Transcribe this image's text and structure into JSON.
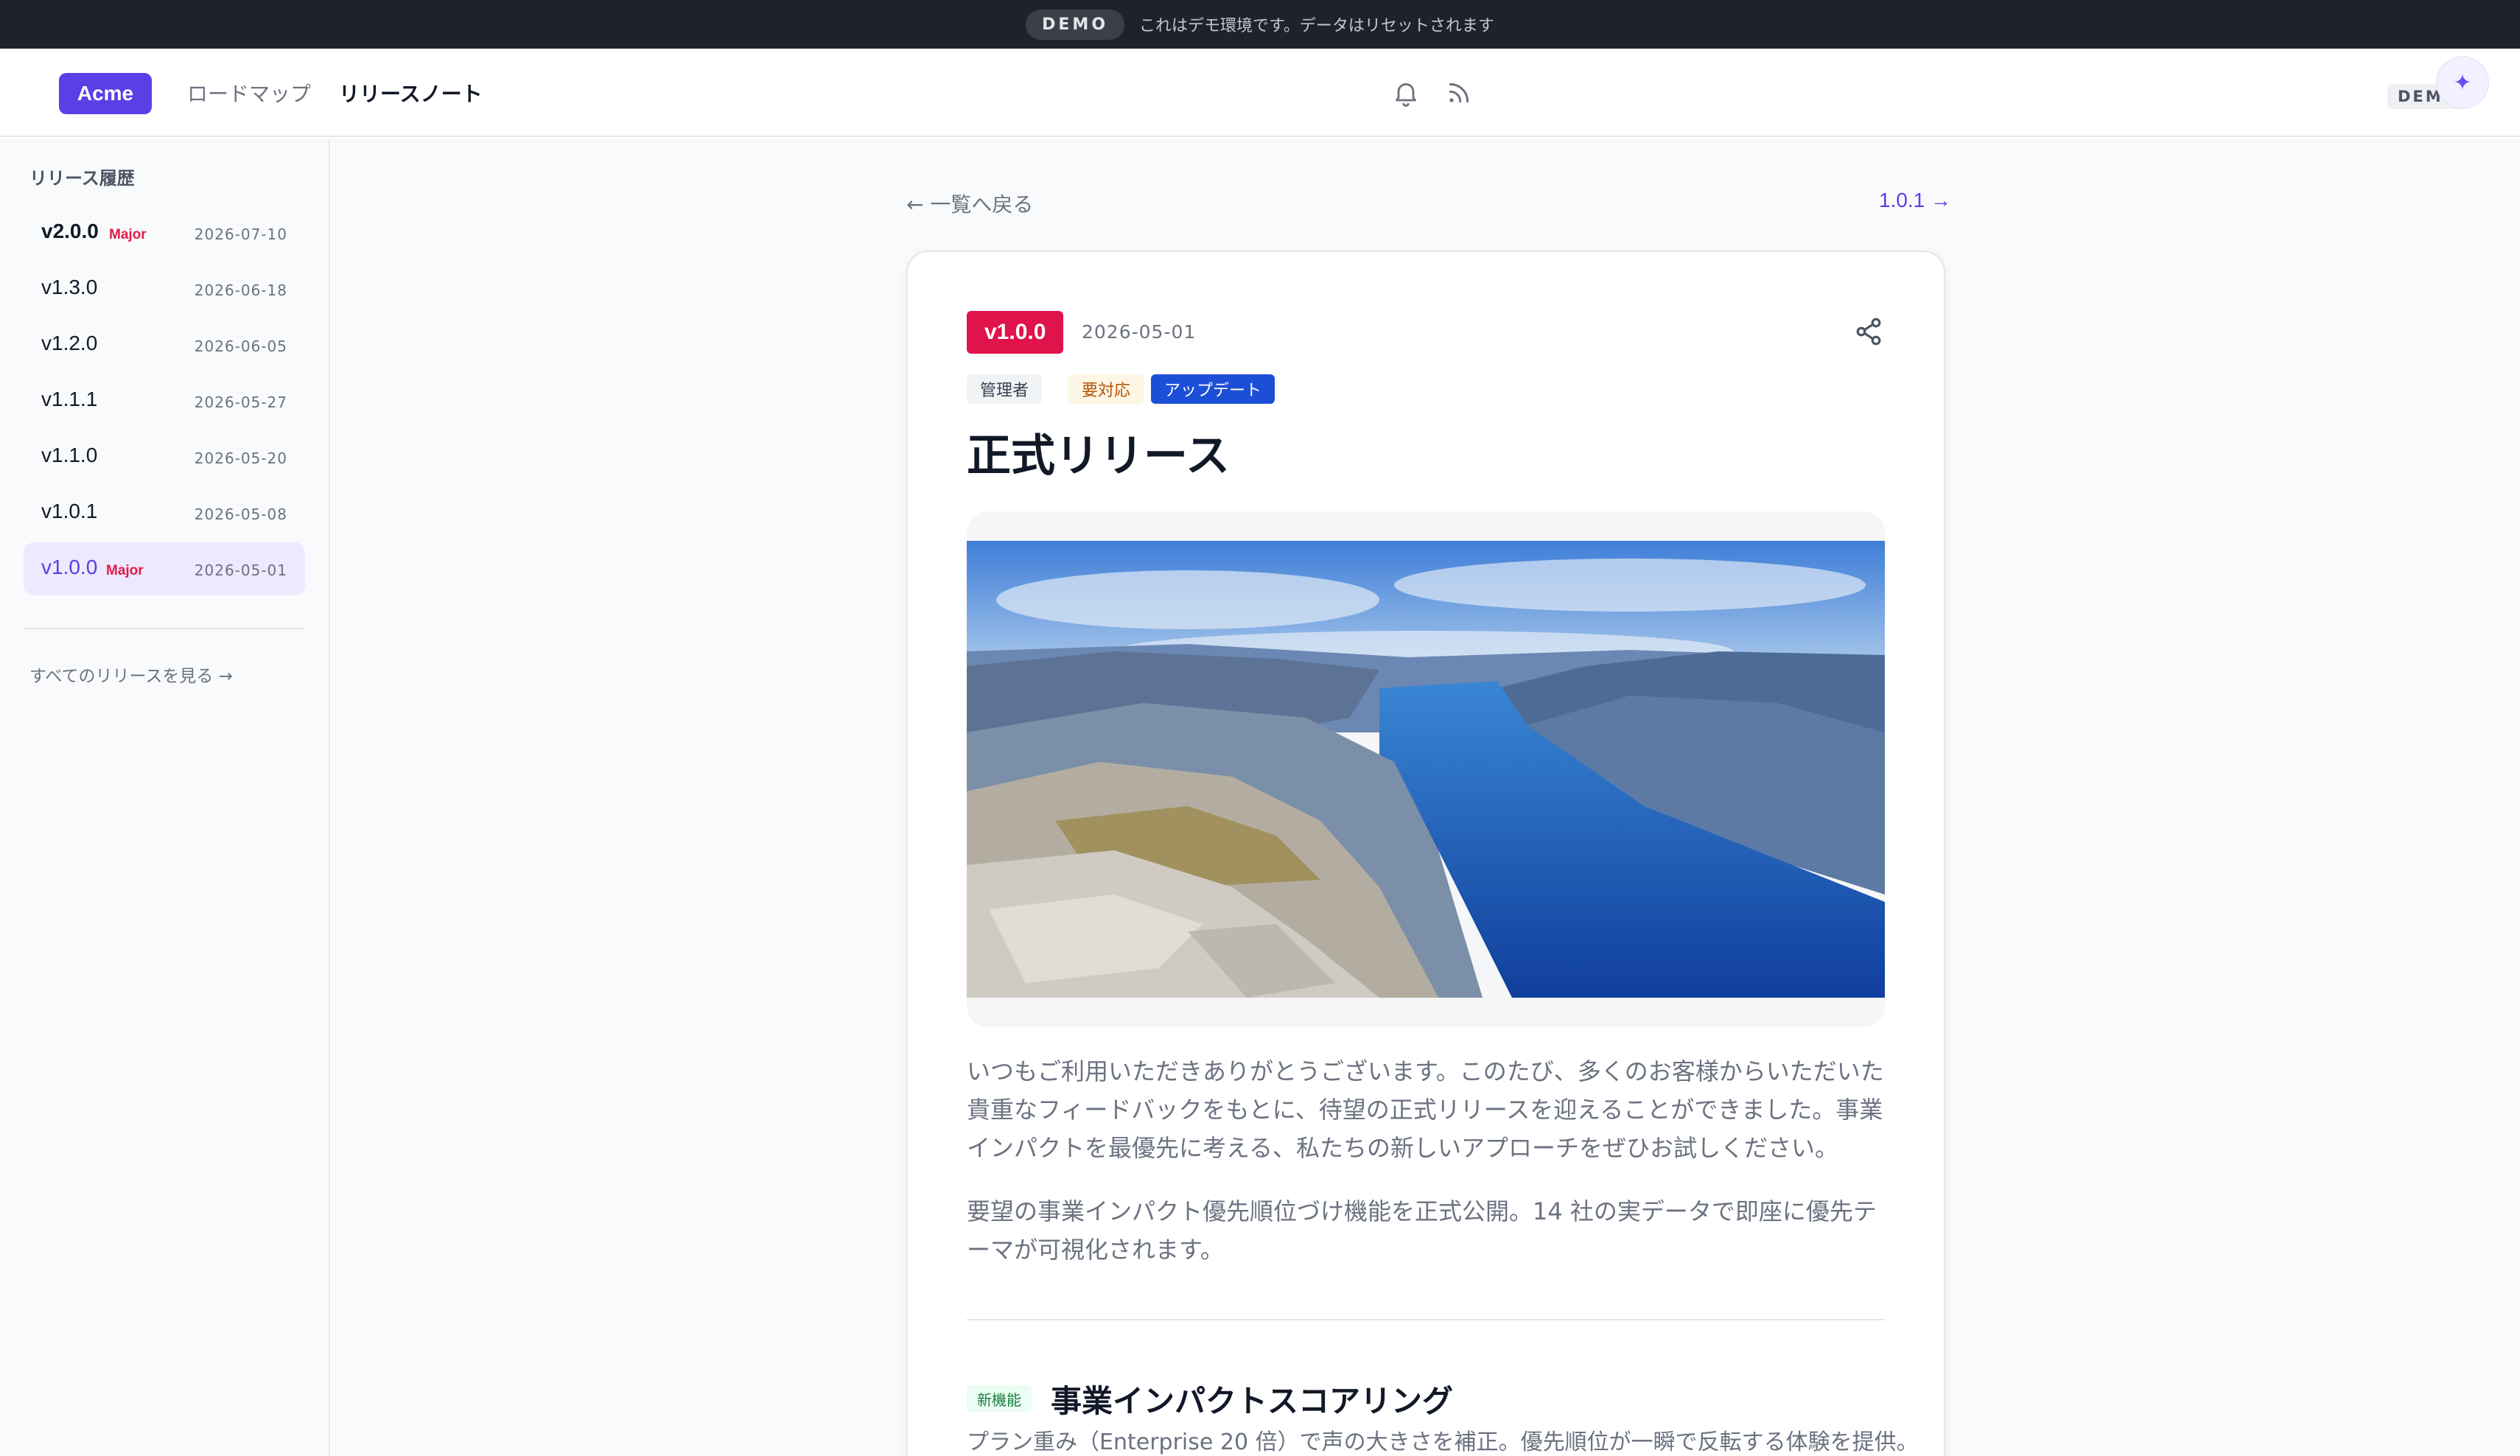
{
  "banner": {
    "badge": "DEMO",
    "message": "これはデモ環境です。データはリセットされます"
  },
  "header": {
    "logo": "Acme",
    "nav": [
      {
        "label": "ロードマップ"
      },
      {
        "label": "リリースノート"
      }
    ],
    "demo_tag": "DEMO",
    "icons": [
      "bell-icon",
      "rss-icon",
      "sparkle-icon"
    ]
  },
  "sidebar": {
    "title": "リリース履歴",
    "items": [
      {
        "version": "v2.0.0",
        "major": "Major",
        "date": "2026-07-10"
      },
      {
        "version": "v1.3.0",
        "major": "",
        "date": "2026-06-18"
      },
      {
        "version": "v1.2.0",
        "major": "",
        "date": "2026-06-05"
      },
      {
        "version": "v1.1.1",
        "major": "",
        "date": "2026-05-27"
      },
      {
        "version": "v1.1.0",
        "major": "",
        "date": "2026-05-20"
      },
      {
        "version": "v1.0.1",
        "major": "",
        "date": "2026-05-08"
      },
      {
        "version": "v1.0.0",
        "major": "Major",
        "date": "2026-05-01",
        "selected": true
      }
    ],
    "all_link": "すべてのリリースを見る →"
  },
  "main": {
    "back_link": "← 一覧へ戻る",
    "next_link": "1.0.1 →",
    "release": {
      "version": "v1.0.0",
      "date": "2026-05-01",
      "tags": [
        "管理者",
        "要対応",
        "アップデート"
      ],
      "title": "正式リリース",
      "body": [
        "いつもご利用いただきありがとうございます。このたび、多くのお客様からいただいた貴重なフィードバックをもとに、待望の正式リリースを迎えることができました。事業インパクトを最優先に考える、私たちの新しいアプローチをぜひお試しください。",
        "要望の事業インパクト優先順位づけ機能を正式公開。14 社の実データで即座に優先テーマが可視化されます。"
      ],
      "feature": {
        "tag": "新機能",
        "title": "事業インパクトスコアリング",
        "description": "プラン重み（Enterprise 20 倍）で声の大きさを補正。優先順位が一瞬で反転する体験を提供。"
      }
    }
  },
  "colors": {
    "accent": "#5b3ee6",
    "major": "#e11d48",
    "version_badge": "#e0134a",
    "update_tag": "#1d4ed8"
  }
}
